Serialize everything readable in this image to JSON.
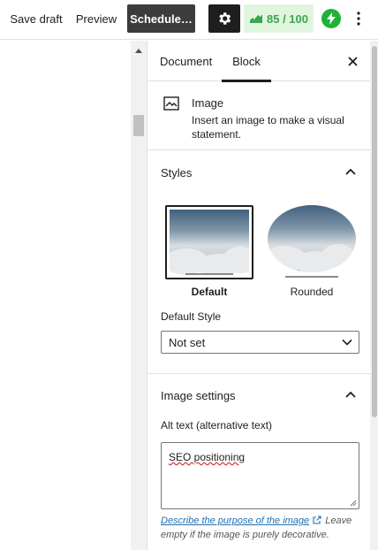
{
  "topbar": {
    "save_draft": "Save draft",
    "preview": "Preview",
    "schedule": "Schedule…",
    "score": "85 / 100",
    "icons": [
      "gear-icon",
      "seo-score-icon",
      "bolt-icon",
      "more-vertical-icon"
    ]
  },
  "colors": {
    "accent_dark": "#1e1e1e",
    "score_bg": "#e0f5dd",
    "score_text": "#3aa552",
    "bolt_green": "#1db238",
    "link": "#2271b1"
  },
  "sidebar": {
    "tabs": [
      {
        "label": "Document",
        "active": false
      },
      {
        "label": "Block",
        "active": true
      }
    ],
    "block_card": {
      "title": "Image",
      "description": "Insert an image to make a visual statement."
    },
    "styles_panel": {
      "title": "Styles",
      "options": [
        {
          "label": "Default",
          "selected": true
        },
        {
          "label": "Rounded",
          "selected": false
        }
      ],
      "default_style_label": "Default Style",
      "default_style_value": "Not set"
    },
    "image_settings": {
      "title": "Image settings",
      "alt_label": "Alt text (alternative text)",
      "alt_value": "SEO positioning",
      "help_link": "Describe the purpose of the image",
      "help_text": "Leave empty if the image is purely decorative."
    }
  }
}
